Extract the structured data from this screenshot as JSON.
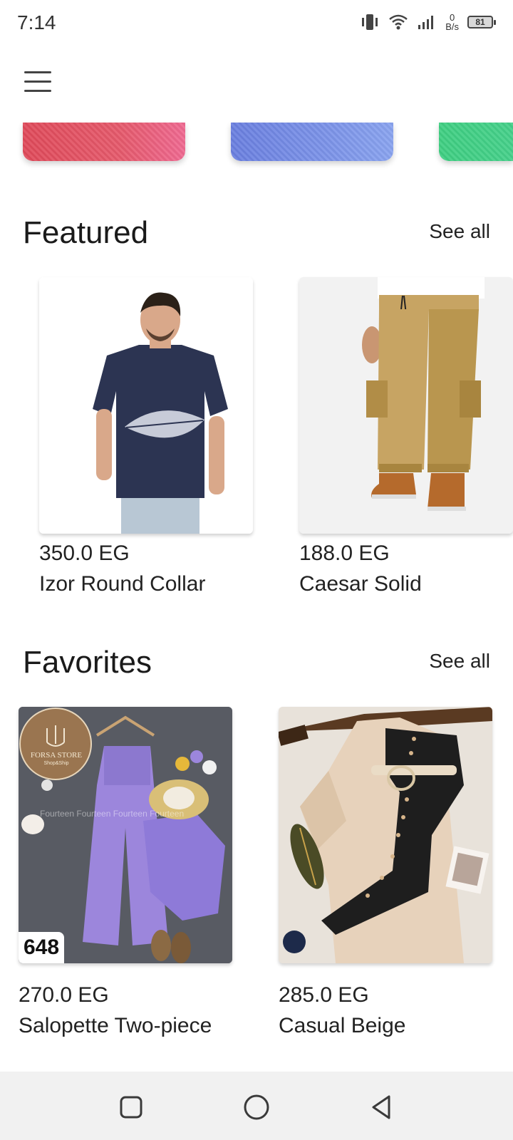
{
  "status_bar": {
    "time": "7:14",
    "net_speed_value": "0",
    "net_speed_unit": "B/s",
    "battery": "81"
  },
  "icons": {
    "menu": "hamburger-menu-icon",
    "vibrate": "vibrate-icon",
    "wifi": "wifi-icon",
    "signal": "signal-icon"
  },
  "categories": [
    {
      "color": "#e65a6c"
    },
    {
      "color": "#7b92e8"
    },
    {
      "color": "#45d08a"
    }
  ],
  "featured": {
    "title": "Featured",
    "see_all": "See all",
    "items": [
      {
        "price": "350.0 EG",
        "name": "Izor Round Collar"
      },
      {
        "price": "188.0 EG",
        "name": "Caesar Solid"
      }
    ]
  },
  "favorites": {
    "title": "Favorites",
    "see_all": "See all",
    "items": [
      {
        "price": "270.0 EG",
        "name": "Salopette Two-piece",
        "badge": "648",
        "logo_text": "FORSA STORE",
        "logo_sub": "Shop&Ship",
        "watermark": "Fourteen Fourteen Fourteen Fourteen"
      },
      {
        "price": "285.0 EG",
        "name": "Casual Beige"
      }
    ]
  }
}
